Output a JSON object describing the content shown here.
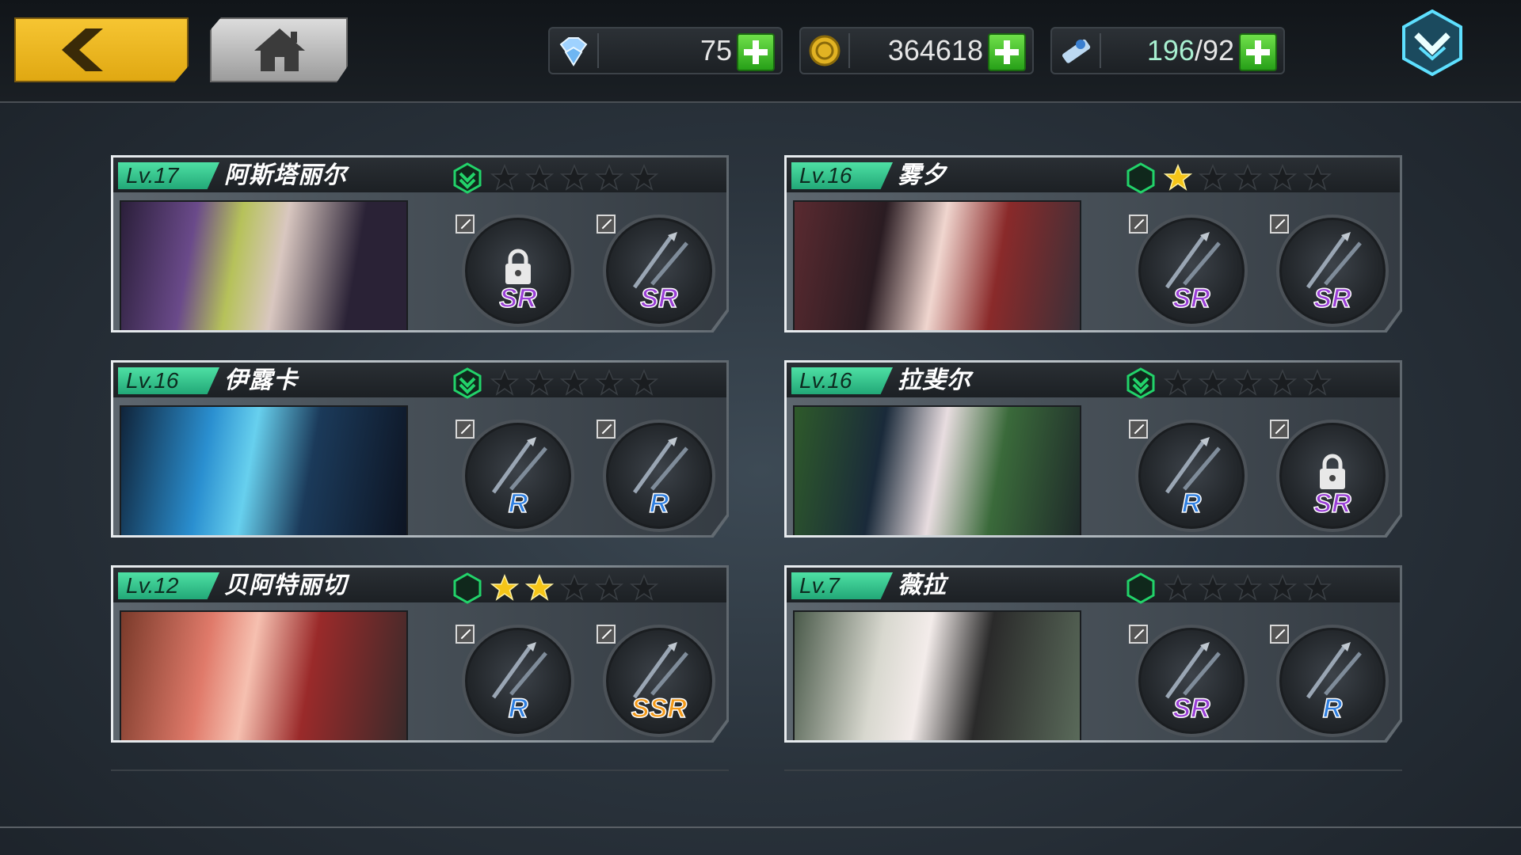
{
  "topbar": {
    "back_label": "back",
    "home_label": "home",
    "resources": [
      {
        "name": "diamond",
        "icon": "diamond-icon",
        "value": "75"
      },
      {
        "name": "gold",
        "icon": "gold-coin-icon",
        "value": "364618"
      },
      {
        "name": "stamina",
        "icon": "stamina-ticket-icon",
        "current": "196",
        "max": "/92"
      }
    ],
    "menu_icon": "chevron-down-menu-icon"
  },
  "colors": {
    "accent_green": "#2ed18a",
    "gold_button": "#f1bb22",
    "star_gold": "#f5c518",
    "rank_green": "#22d36a",
    "rarity_sr": "#9a3fd6",
    "rarity_r": "#2f7fe0",
    "rarity_ssr": "#f39a1a"
  },
  "characters": [
    {
      "level": "Lv.17",
      "name": "阿斯塔丽尔",
      "rank": "upgrade",
      "stars": 0,
      "portrait": "gasmask-girl-portrait",
      "weapons": [
        {
          "rarity": "SR",
          "locked": true
        },
        {
          "rarity": "SR",
          "locked": false
        }
      ]
    },
    {
      "level": "Lv.16",
      "name": "雾夕",
      "rank": "plain",
      "stars": 1,
      "portrait": "shrine-maiden-portrait",
      "weapons": [
        {
          "rarity": "SR",
          "locked": false
        },
        {
          "rarity": "SR",
          "locked": false
        }
      ]
    },
    {
      "level": "Lv.16",
      "name": "伊露卡",
      "rank": "upgrade",
      "stars": 0,
      "portrait": "blue-hair-girl-portrait",
      "weapons": [
        {
          "rarity": "R",
          "locked": false
        },
        {
          "rarity": "R",
          "locked": false
        }
      ]
    },
    {
      "level": "Lv.16",
      "name": "拉斐尔",
      "rank": "upgrade",
      "stars": 0,
      "portrait": "dark-hair-girl-portrait",
      "weapons": [
        {
          "rarity": "R",
          "locked": false
        },
        {
          "rarity": "SR",
          "locked": true
        }
      ]
    },
    {
      "level": "Lv.12",
      "name": "贝阿特丽切",
      "rank": "plain",
      "stars": 2,
      "portrait": "red-hair-girl-portrait",
      "weapons": [
        {
          "rarity": "R",
          "locked": false
        },
        {
          "rarity": "SSR",
          "locked": false
        }
      ]
    },
    {
      "level": "Lv.7",
      "name": "薇拉",
      "rank": "plain",
      "stars": 0,
      "portrait": "white-hair-girl-portrait",
      "weapons": [
        {
          "rarity": "SR",
          "locked": false
        },
        {
          "rarity": "R",
          "locked": false
        }
      ]
    }
  ]
}
